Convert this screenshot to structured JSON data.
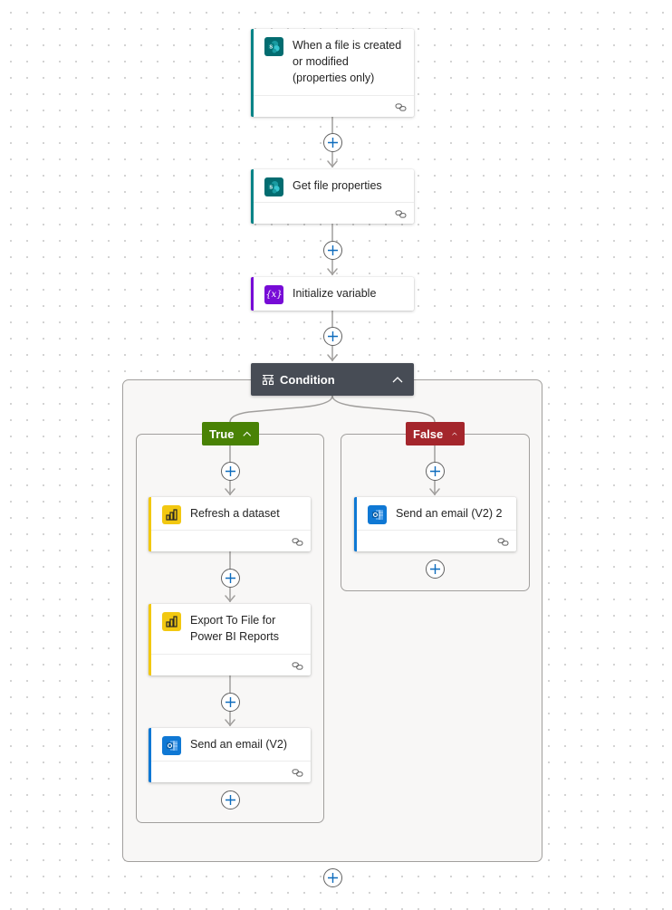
{
  "trigger": {
    "title": "When a file is created or modified (properties only)",
    "title_lines": [
      "When a file is created",
      "or modified",
      "(properties only)"
    ],
    "icon": "sharepoint-icon",
    "accent": "#038387"
  },
  "actions": [
    {
      "title": "Get file properties",
      "icon": "sharepoint-icon",
      "accent": "#038387"
    },
    {
      "title": "Initialize variable",
      "icon": "variable-icon",
      "accent": "#770bd6"
    }
  ],
  "condition": {
    "title": "Condition",
    "icon": "condition-icon",
    "header_color": "#474c55",
    "true_branch": {
      "label": "True",
      "color": "#498205",
      "actions": [
        {
          "title": "Refresh a dataset",
          "icon": "power-bi-icon",
          "accent": "#f2c811"
        },
        {
          "title": "Export To File for Power BI Reports",
          "title_lines": [
            "Export To File for",
            "Power BI Reports"
          ],
          "icon": "power-bi-icon",
          "accent": "#f2c811"
        },
        {
          "title": "Send an email (V2)",
          "icon": "outlook-icon",
          "accent": "#0f78d4"
        }
      ]
    },
    "false_branch": {
      "label": "False",
      "color": "#a4262c",
      "actions": [
        {
          "title": "Send an email (V2) 2",
          "icon": "outlook-icon",
          "accent": "#0f78d4"
        }
      ]
    }
  },
  "colors": {
    "plus_accent": "#0f6cbd",
    "connector": "#a19f9d",
    "sharepoint": "#036c70",
    "variable": "#770bd6",
    "power_bi": "#f2c811",
    "outlook": "#0f78d4"
  }
}
